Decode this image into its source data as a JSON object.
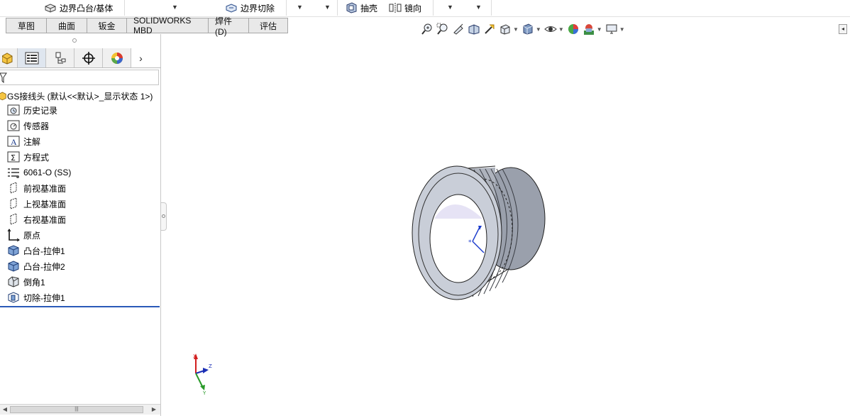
{
  "toolbar": {
    "boundary_boss_label": "边界凸台/基体",
    "boundary_cut_label": "边界切除",
    "shell_label": "抽壳",
    "mirror_label": "镜向"
  },
  "tabs": [
    "草图",
    "曲面",
    "钣金",
    "SOLIDWORKS MBD",
    "焊件(D)",
    "评估"
  ],
  "feature_tree": {
    "root": "GS接线头  (默认<<默认>_显示状态 1>)",
    "items": [
      {
        "label": "历史记录",
        "icon": "history-icon"
      },
      {
        "label": "传感器",
        "icon": "sensor-icon"
      },
      {
        "label": "注解",
        "icon": "annotation-icon"
      },
      {
        "label": "方程式",
        "icon": "equation-icon"
      },
      {
        "label": "6061-O (SS)",
        "icon": "material-icon"
      },
      {
        "label": "前视基准面",
        "icon": "plane-icon"
      },
      {
        "label": "上视基准面",
        "icon": "plane-icon"
      },
      {
        "label": "右视基准面",
        "icon": "plane-icon"
      },
      {
        "label": "原点",
        "icon": "origin-icon"
      },
      {
        "label": "凸台-拉伸1",
        "icon": "boss-extrude-icon"
      },
      {
        "label": "凸台-拉伸2",
        "icon": "boss-extrude-icon"
      },
      {
        "label": "倒角1",
        "icon": "chamfer-icon"
      },
      {
        "label": "切除-拉伸1",
        "icon": "cut-extrude-icon"
      }
    ]
  },
  "triad": {
    "x": "X",
    "y": "Y",
    "z": "Z"
  },
  "colors": {
    "tab_bg": "#e9e9e9",
    "rollback_bar": "#2a5ab8",
    "model_face": "#c9ced8",
    "model_inner": "#ffffff",
    "accent_blue": "#2a5ab8"
  }
}
